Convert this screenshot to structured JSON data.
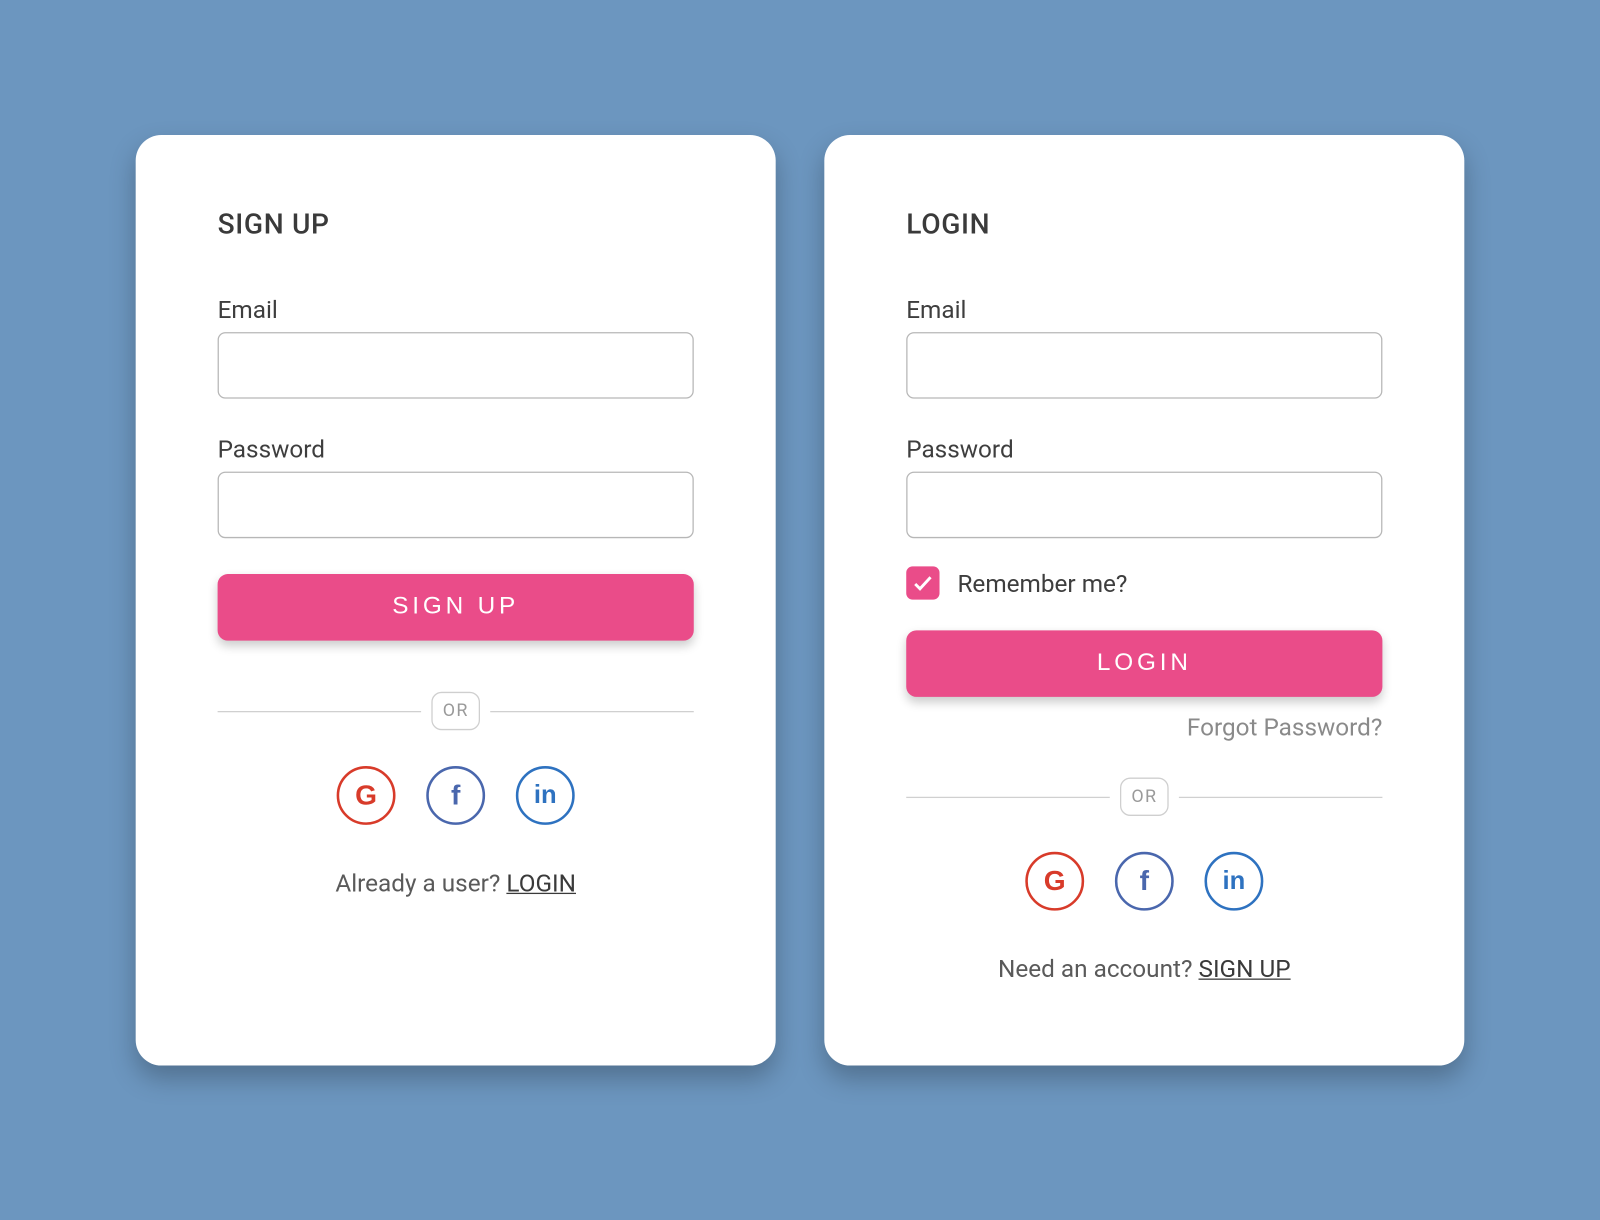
{
  "signup": {
    "title": "SIGN UP",
    "email_label": "Email",
    "password_label": "Password",
    "submit": "SIGN UP",
    "divider": "OR",
    "footer_prompt": "Already a user? ",
    "footer_link": "LOGIN"
  },
  "login": {
    "title": "LOGIN",
    "email_label": "Email",
    "password_label": "Password",
    "remember_label": "Remember me?",
    "remember_checked": true,
    "submit": "LOGIN",
    "forgot": "Forgot Password?",
    "divider": "OR",
    "footer_prompt": "Need an account? ",
    "footer_link": "SIGN UP"
  },
  "social": {
    "google_glyph": "G",
    "facebook_glyph": "f",
    "linkedin_glyph": "in"
  },
  "colors": {
    "bg": "#6c96bf",
    "primary": "#ea4c89",
    "google": "#d83b2a",
    "facebook": "#4a67ad",
    "linkedin": "#2e72c0"
  }
}
